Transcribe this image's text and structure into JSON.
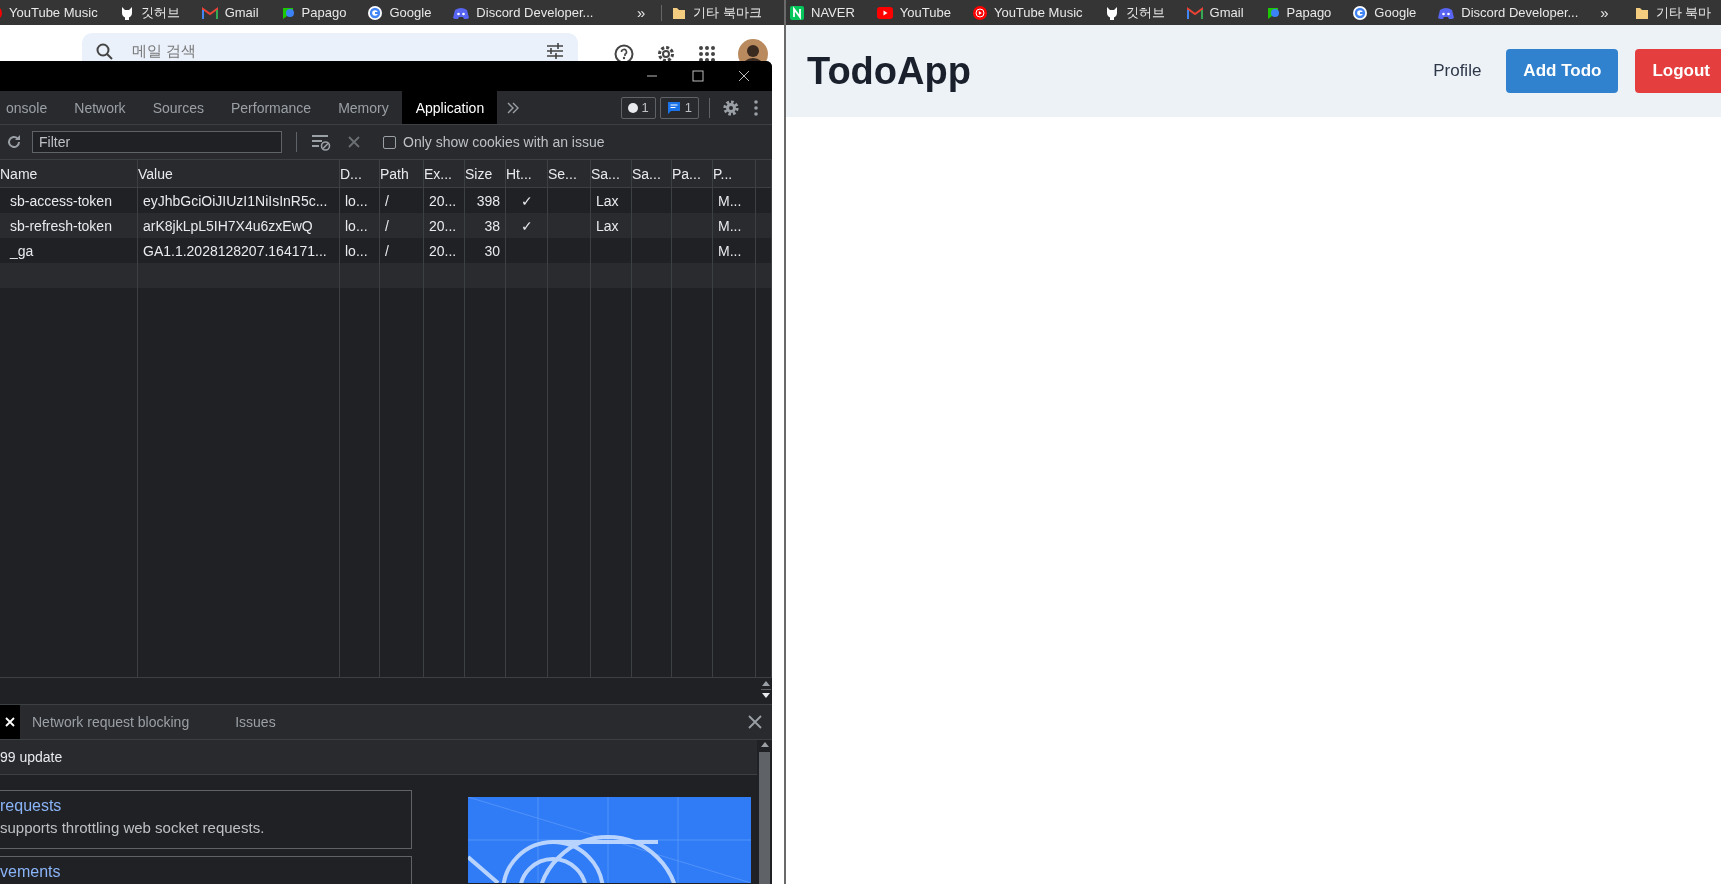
{
  "left_browser": {
    "bookmarks": [
      {
        "label": "YouTube Music",
        "kind": "ytmusic"
      },
      {
        "label": "깃허브",
        "kind": "github"
      },
      {
        "label": "Gmail",
        "kind": "gmail"
      },
      {
        "label": "Papago",
        "kind": "papago"
      },
      {
        "label": "Google",
        "kind": "google"
      },
      {
        "label": "Discord Developer...",
        "kind": "discord"
      }
    ],
    "overflow": "»",
    "other_bookmarks": "기타 북마크"
  },
  "gmail": {
    "search": {
      "placeholder": "메일 검색"
    }
  },
  "devtools": {
    "tabs": [
      {
        "label": "onsole",
        "selected": false
      },
      {
        "label": "Network",
        "selected": false
      },
      {
        "label": "Sources",
        "selected": false
      },
      {
        "label": "Performance",
        "selected": false
      },
      {
        "label": "Memory",
        "selected": false
      },
      {
        "label": "Application",
        "selected": true
      }
    ],
    "issue_count": "1",
    "message_count": "1",
    "filter": {
      "placeholder": "Filter"
    },
    "only_issues": {
      "label": "Only show cookies with an issue",
      "checked": false
    },
    "table": {
      "columns": [
        "Name",
        "Value",
        "D...",
        "Path",
        "Ex...",
        "Size",
        "Ht...",
        "Se...",
        "Sa...",
        "Sa...",
        "Pa...",
        "P..."
      ],
      "rows": [
        {
          "cells": [
            "sb-access-token",
            "eyJhbGciOiJIUzI1NiIsInR5c...",
            "lo...",
            "/",
            "20...",
            "398",
            "✓",
            "",
            "Lax",
            "",
            "",
            "M..."
          ]
        },
        {
          "cells": [
            "sb-refresh-token",
            "arK8jkLpL5IH7X4u6zxEwQ",
            "lo...",
            "/",
            "20...",
            "38",
            "✓",
            "",
            "Lax",
            "",
            "",
            "M..."
          ]
        },
        {
          "cells": [
            "_ga",
            "GA1.1.2028128207.164171...",
            "lo...",
            "/",
            "20...",
            "30",
            "",
            "",
            "",
            "",
            "",
            "M..."
          ]
        }
      ]
    },
    "drawer": {
      "tabs": [
        {
          "label": "Network request blocking",
          "selected": false
        },
        {
          "label": "Issues",
          "selected": false
        }
      ],
      "heading": "99 update",
      "cards": [
        {
          "title": "requests",
          "text": "supports throttling web socket requests."
        },
        {
          "title": "vements"
        }
      ]
    }
  },
  "right_browser": {
    "bookmarks": [
      {
        "label": "NAVER",
        "kind": "naver"
      },
      {
        "label": "YouTube",
        "kind": "youtube"
      },
      {
        "label": "YouTube Music",
        "kind": "ytmusic"
      },
      {
        "label": "깃허브",
        "kind": "github"
      },
      {
        "label": "Gmail",
        "kind": "gmail"
      },
      {
        "label": "Papago",
        "kind": "papago"
      },
      {
        "label": "Google",
        "kind": "google"
      },
      {
        "label": "Discord Developer...",
        "kind": "discord"
      }
    ],
    "overflow": "»",
    "other_bookmarks": "기타 북마"
  },
  "app": {
    "title": "TodoApp",
    "nav": [
      {
        "label": "Profile",
        "kind": "link"
      },
      {
        "label": "Add Todo",
        "kind": "primary"
      },
      {
        "label": "Logout",
        "kind": "danger"
      }
    ]
  }
}
